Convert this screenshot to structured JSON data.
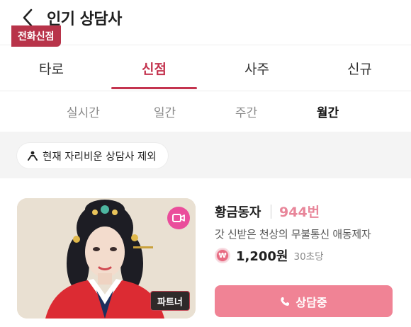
{
  "header": {
    "title": "인기 상담사",
    "back_icon": "chevron-left-icon"
  },
  "tabs": [
    {
      "label": "타로",
      "active": false
    },
    {
      "label": "신점",
      "active": true
    },
    {
      "label": "사주",
      "active": false
    },
    {
      "label": "신규",
      "active": false
    }
  ],
  "subtabs": [
    {
      "label": "실시간",
      "active": false
    },
    {
      "label": "일간",
      "active": false
    },
    {
      "label": "주간",
      "active": false
    },
    {
      "label": "월간",
      "active": true
    }
  ],
  "filter": {
    "label": "현재 자리비운 상담사 제외",
    "icon": "away-person-icon"
  },
  "counselor": {
    "category_badge": "전화신점",
    "video_icon": "video-camera-icon",
    "partner_badge": "파트너",
    "name": "황금동자",
    "code": "944번",
    "description": "갓 신받은 천상의 무불통신 애동제자",
    "price": "1,200원",
    "price_unit": "30초당",
    "consult_button": "상담중",
    "consult_icon": "phone-icon"
  },
  "colors": {
    "accent": "#c4344f",
    "button": "#f08395",
    "code": "#e8869a",
    "video_badge": "#ea4d9b"
  }
}
